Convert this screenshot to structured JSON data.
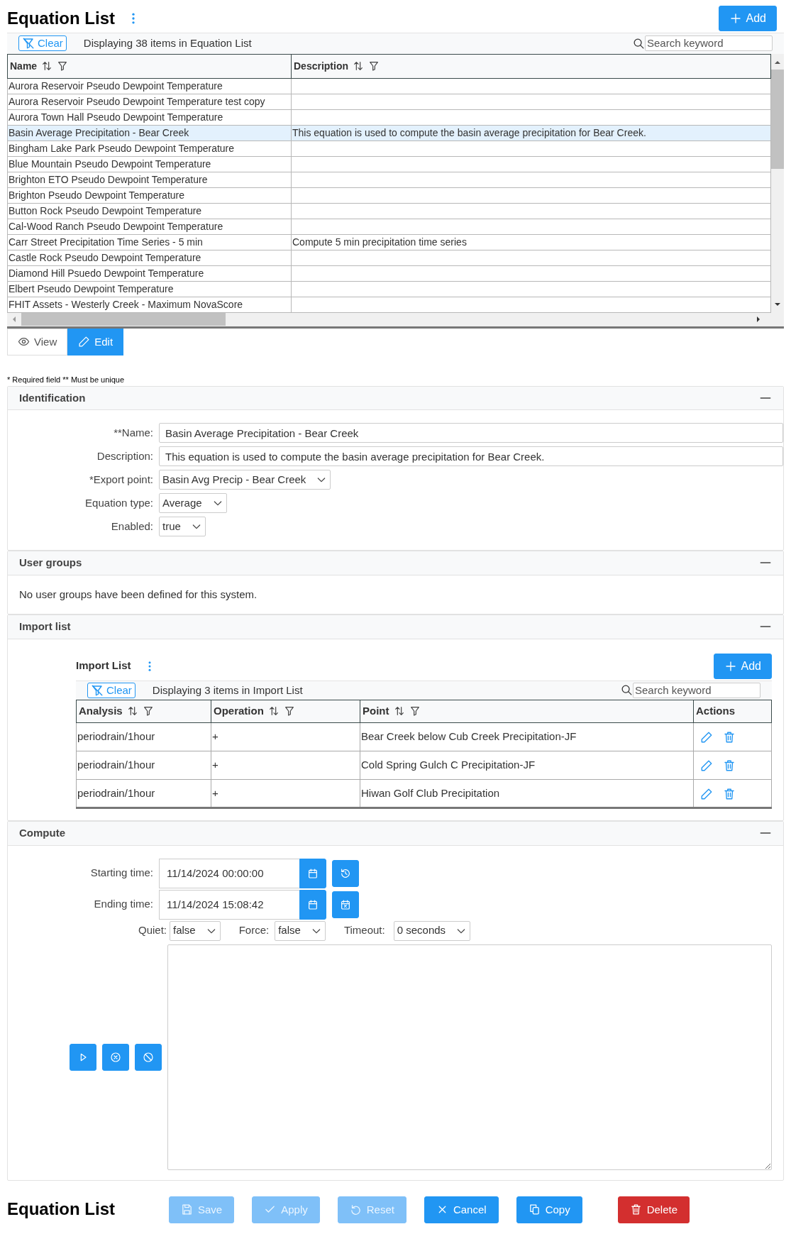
{
  "header": {
    "title": "Equation List",
    "add_label": "Add"
  },
  "list_toolbar": {
    "clear_label": "Clear",
    "summary": "Displaying 38 items in Equation List",
    "search_placeholder": "Search keyword"
  },
  "table": {
    "columns": [
      "Name",
      "Description"
    ],
    "rows": [
      {
        "name": "Aurora Reservoir Pseudo Dewpoint Temperature",
        "description": "",
        "selected": false
      },
      {
        "name": "Aurora Reservoir Pseudo Dewpoint Temperature test copy",
        "description": "",
        "selected": false
      },
      {
        "name": "Aurora Town Hall Pseudo Dewpoint Temperature",
        "description": "",
        "selected": false
      },
      {
        "name": "Basin Average Precipitation - Bear Creek",
        "description": "This equation is used to compute the basin average precipitation for Bear Creek.",
        "selected": true
      },
      {
        "name": "Bingham Lake Park Pseudo Dewpoint Temperature",
        "description": "",
        "selected": false
      },
      {
        "name": "Blue Mountain Pseudo Dewpoint Temperature",
        "description": "",
        "selected": false
      },
      {
        "name": "Brighton ETO Pseudo Dewpoint Temperature",
        "description": "",
        "selected": false
      },
      {
        "name": "Brighton Pseudo Dewpoint Temperature",
        "description": "",
        "selected": false
      },
      {
        "name": "Button Rock Pseudo Dewpoint Temperature",
        "description": "",
        "selected": false
      },
      {
        "name": "Cal-Wood Ranch Pseudo Dewpoint Temperature",
        "description": "",
        "selected": false
      },
      {
        "name": "Carr Street Precipitation Time Series - 5 min",
        "description": "Compute 5 min precipitation time series",
        "selected": false
      },
      {
        "name": "Castle Rock Pseudo Dewpoint Temperature",
        "description": "",
        "selected": false
      },
      {
        "name": "Diamond Hill Psuedo Dewpoint Temperature",
        "description": "",
        "selected": false
      },
      {
        "name": "Elbert Pseudo Dewpoint Temperature",
        "description": "",
        "selected": false
      },
      {
        "name": "FHIT Assets - Westerly Creek - Maximum NovaScore",
        "description": "",
        "selected": false
      }
    ]
  },
  "mode_tabs": [
    {
      "label": "View",
      "kind": "view",
      "selected": false
    },
    {
      "label": "Edit",
      "kind": "edit",
      "selected": true
    }
  ],
  "required_note": "* Required field ** Must be unique",
  "identification": {
    "title": "Identification",
    "expanded": true,
    "fields": [
      {
        "label": "**Name:",
        "value": "Basin Average Precipitation - Bear Creek",
        "kind": "text"
      },
      {
        "label": "Description:",
        "value": "This equation is used to compute the basin average precipitation for Bear Creek.",
        "kind": "text"
      },
      {
        "label": "*Export point:",
        "value": "Basin Avg Precip - Bear Creek",
        "kind": "select"
      },
      {
        "label": "Equation type:",
        "value": "Average",
        "kind": "select"
      },
      {
        "label": "Enabled:",
        "value": "true",
        "kind": "select"
      }
    ]
  },
  "user_groups": {
    "title": "User groups",
    "expanded": true,
    "message": "No user groups have been defined for this system."
  },
  "import_list": {
    "title": "Import list",
    "expanded": true,
    "list_title": "Import List",
    "add_label": "Add",
    "clear_label": "Clear",
    "summary": "Displaying 3 items in Import List",
    "search_placeholder": "Search keyword",
    "columns": [
      "Analysis",
      "Operation",
      "Point",
      "Actions"
    ],
    "rows": [
      {
        "analysis": "periodrain/1hour",
        "operation": "+",
        "point": "Bear Creek below Cub Creek Precipitation-JF"
      },
      {
        "analysis": "periodrain/1hour",
        "operation": "+",
        "point": "Cold Spring Gulch C Precipitation-JF"
      },
      {
        "analysis": "periodrain/1hour",
        "operation": "+",
        "point": "Hiwan Golf Club Precipitation"
      }
    ]
  },
  "compute": {
    "title": "Compute",
    "expanded": true,
    "starting_label": "Starting time:",
    "starting_value": "11/14/2024 00:00:00",
    "ending_label": "Ending time:",
    "ending_value": "11/14/2024 15:08:42",
    "options": [
      {
        "label": "Quiet:",
        "value": "false"
      },
      {
        "label": "Force:",
        "value": "false"
      },
      {
        "label": "Timeout:",
        "value": "0 seconds"
      }
    ]
  },
  "footer": {
    "title": "Equation List",
    "buttons": [
      {
        "label": "Save",
        "kind": "save",
        "disabled": true
      },
      {
        "label": "Apply",
        "kind": "apply",
        "disabled": true
      },
      {
        "label": "Reset",
        "kind": "reset",
        "disabled": true
      },
      {
        "label": "Cancel",
        "kind": "cancel",
        "disabled": false
      },
      {
        "label": "Copy",
        "kind": "copy",
        "disabled": false
      },
      {
        "label": "Delete",
        "kind": "delete",
        "disabled": false
      }
    ]
  }
}
